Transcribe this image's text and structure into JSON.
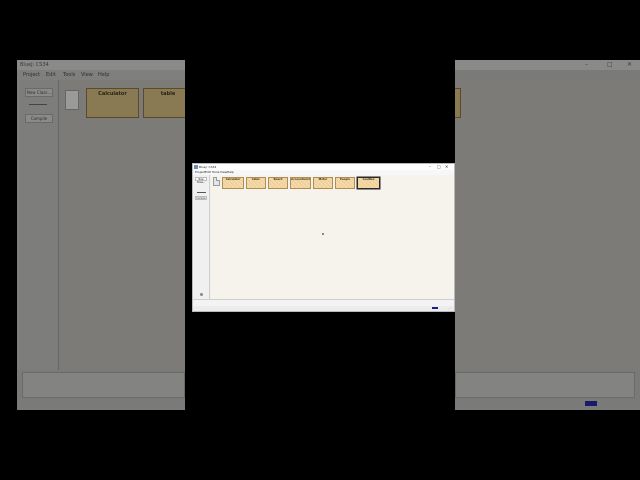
{
  "window": {
    "title": "BlueJ: CS34",
    "controls": [
      "–",
      "□",
      "✕"
    ]
  },
  "menubar": {
    "items": [
      "Project",
      "Edit",
      "Tools",
      "View",
      "Help"
    ]
  },
  "sidebar": {
    "new_class_label": "New Class...",
    "arrow_label": "",
    "compile_label": "Compile"
  },
  "classes": [
    {
      "name": "Calculator"
    },
    {
      "name": "table"
    },
    {
      "name": "Board"
    },
    {
      "name": "AccountsList"
    },
    {
      "name": "Motor"
    },
    {
      "name": "People"
    },
    {
      "name": "CoolBox"
    }
  ],
  "background": {
    "title": "BlueJ: CS34",
    "menu": [
      "Project",
      "Edit",
      "Tools",
      "View",
      "Help"
    ],
    "new_class_label": "New Class...",
    "compile_label": "Compile",
    "classes": [
      "Calculator",
      "table"
    ]
  }
}
